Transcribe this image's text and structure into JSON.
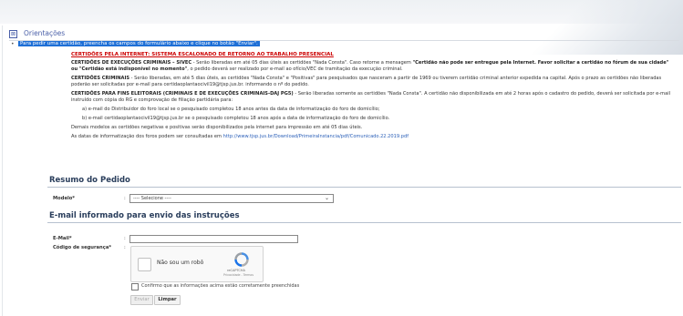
{
  "section": {
    "title": "Orientações",
    "toggle_symbol": "⊠"
  },
  "intro": {
    "bullet": "•",
    "lead": "Para pedir uma certidão, preencha os campos do formulário abaixo e clique no botão \"Enviar\"."
  },
  "notice": {
    "headline": "CERTIDÕES PELA INTERNET: SISTEMA ESCALONADO DE RETORNO AO TRABALHO PRESENCIAL",
    "para1_label": "CERTIDÕES DE EXECUÇÕES CRIMINAIS – SIVEC",
    "para1_text": " - Serão liberadas em até 05 dias úteis as certidões \"Nada Consta\". Caso retorne a mensagem ",
    "para1_bold": "\"Certidão não pode ser entregue pela Internet. Favor solicitar a certidão no fórum de sua cidade\" ou \"Certidão está indisponível no momento\"",
    "para1_tail": ", o pedido deverá ser realizado por e-mail ao ofício/VEC de tramitação da execução criminal.",
    "para2_label": "CERTIDÕES CRIMINAIS",
    "para2_text": " - Serão liberadas, em até 5 dias úteis, as certidões \"Nada Consta\" e \"Positivas\" para pesquisados que nasceram a partir de 1969 ou tiverem certidão criminal anterior expedida na capital. Após o prazo as certidões não liberadas poderão ser solicitadas por e-mail para certidaoplantaocivil19@tjsp.jus.br. informando o nº do pedido.",
    "para3_label": "CERTIDÕES PARA FINS ELEITORAIS (CRIMINAIS E DE EXECUÇÕES CRIMINAIS-DAJ PG5)",
    "para3_text": " - Serão liberadas somente as certidões \"Nada Consta\". A certidão não disponibilizada em até 2 horas após o cadastro do pedido, deverá ser solicitada por e-mail instruído com cópia do RG e comprovação de filiação partidária para:",
    "item_a": "a) e-mail do Distribuidor do foro local se o pesquisado completou 18 anos antes da data de informatização do foro de domicílio;",
    "item_b": "b) e-mail certidaoplantaocivil19@tjsp.jus.br se o pesquisado completou 18 anos após a data de informatização do foro de domicílio.",
    "line_models": "Demais modelos as certidões negativas e positivas serão disponibilizados pela internet para impressão em até 05 dias úteis.",
    "line_dates_prefix": "As datas de informatização dos foros podem ser consultadas em ",
    "line_dates_link": "http://www.tjsp.jus.br/Download/PrimeiraInstancia/pdf/Comunicado.22.2019.pdf"
  },
  "summary": {
    "title": "Resumo do Pedido",
    "model_label": "Modelo*",
    "colon": ":",
    "select_value": "---- Selecione ----",
    "select_chevron": "⌄"
  },
  "email_section": {
    "title": "E-mail informado para envio das instruções",
    "email_label": "E-Mail*",
    "security_label": "Código de segurança*",
    "email_value": ""
  },
  "captcha": {
    "label": "Não sou um robô",
    "brand": "reCAPTCHA",
    "links": "Privacidade - Termos"
  },
  "confirm": {
    "label": "Confirmo que as informações acima estão corretamente preenchidas"
  },
  "buttons": {
    "send": "Enviar",
    "clear": "Limpar"
  },
  "colors": {
    "accent": "#4a5fa8",
    "highlight": "#1e6fd6",
    "headline_red": "#cc0000",
    "link": "#2a5fb8"
  }
}
